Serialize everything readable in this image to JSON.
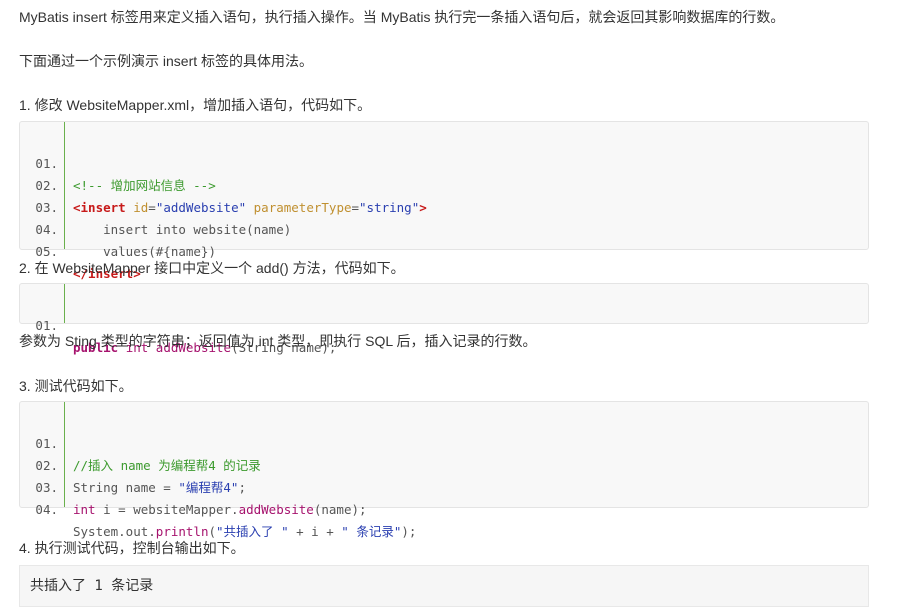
{
  "paragraphs": {
    "intro": "MyBatis insert 标签用来定义插入语句，执行插入操作。当 MyBatis 执行完一条插入语句后，就会返回其影响数据库的行数。",
    "demo": "下面通过一个示例演示 insert 标签的具体用法。",
    "step1": "1. 修改 WebsiteMapper.xml，增加插入语句，代码如下。",
    "step2": "2. 在 WebsiteMapper 接口中定义一个 add() 方法，代码如下。",
    "param_note": "参数为 Sting 类型的字符串；返回值为 int 类型，即执行 SQL 后，插入记录的行数。",
    "step3": "3. 测试代码如下。",
    "step4": "4. 执行测试代码，控制台输出如下。"
  },
  "code_xml": {
    "line_numbers": [
      "01.",
      "02.",
      "03.",
      "04.",
      "05."
    ],
    "l1_comment": "<!-- 增加网站信息 -->",
    "l2_tag_open": "<insert",
    "l2_attr1": "id",
    "l2_eq1": "=",
    "l2_val1": "\"addWebsite\"",
    "l2_attr2": "parameterType",
    "l2_eq2": "=",
    "l2_val2": "\"string\"",
    "l2_tag_close": ">",
    "l3": "    insert into website(name)",
    "l4": "    values(#{name})",
    "l5_tag": "</insert>"
  },
  "code_java": {
    "line_numbers": [
      "01."
    ],
    "kw_public": "public",
    "kw_int": "int",
    "method": "addWebsite",
    "params": "(String name);"
  },
  "code_test": {
    "line_numbers": [
      "01.",
      "02.",
      "03.",
      "04."
    ],
    "l1_comment": "//插入 name 为编程帮4 的记录",
    "l2_pre": "String name = ",
    "l2_str": "\"编程帮4\"",
    "l2_post": ";",
    "l3_kw": "int",
    "l3_mid": " i = websiteMapper.",
    "l3_fn": "addWebsite",
    "l3_post": "(name);",
    "l4_pre": "System.out.",
    "l4_fn": "println",
    "l4_open": "(",
    "l4_str1": "\"共插入了 \"",
    "l4_mid": " + i + ",
    "l4_str2": "\" 条记录\"",
    "l4_close": ");"
  },
  "console": {
    "output": "共插入了 1 条记录"
  }
}
